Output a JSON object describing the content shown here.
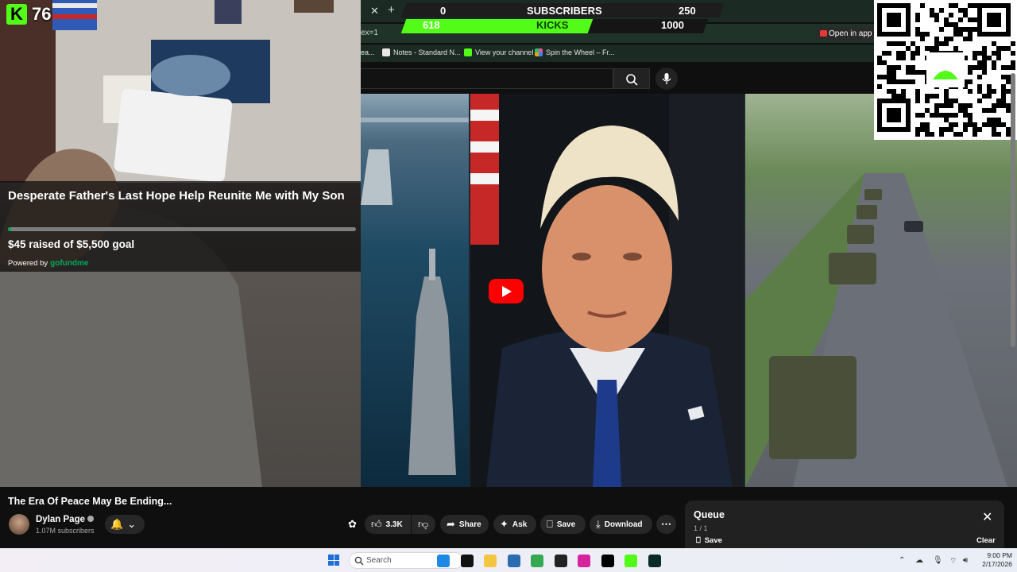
{
  "browser": {
    "address_fragment": "ex=1",
    "open_in_app": "Open in app",
    "bookmarks": [
      {
        "label": "ea...",
        "color": "#7a7a7a"
      },
      {
        "label": "Notes - Standard N...",
        "color": "#e8e8e8"
      },
      {
        "label": "View your channel",
        "color": "#53fc18"
      },
      {
        "label": "Spin the Wheel – Fr...",
        "color": "#e056a0"
      }
    ]
  },
  "goal_widget": {
    "subscribers_label": "SUBSCRIBERS",
    "subscribers_current": "0",
    "subscribers_target": "250",
    "kicks_label": "KICKS",
    "kicks_current": "618",
    "kicks_target": "1000",
    "kicks_progress": 0.618,
    "accent": "#53fc18"
  },
  "stream": {
    "kick_count": "76",
    "brand_color": "#53fc18"
  },
  "fundraiser": {
    "title": "Desperate Father's Last Hope Help Reunite Me with My Son",
    "raised_text": "$45 raised of $5,500 goal",
    "progress": 0.008,
    "powered_by": "Powered by",
    "logo_text": "gofundme",
    "accent": "#02a95c"
  },
  "video": {
    "title": "The Era Of Peace May Be Ending...",
    "channel_name": "Dylan Page",
    "subscribers": "1.07M subscribers",
    "likes": "3.3K",
    "actions": {
      "share": "Share",
      "ask": "Ask",
      "save": "Save",
      "download": "Download"
    }
  },
  "queue": {
    "title": "Queue",
    "count": "1 / 1",
    "save": "Save",
    "clear": "Clear"
  },
  "taskbar": {
    "search_placeholder": "Search",
    "time": "9:00 PM",
    "date": "2/17/2026",
    "apps": [
      {
        "name": "edge-icon",
        "color": "#1e88e5"
      },
      {
        "name": "tiktok-icon",
        "color": "#111111"
      },
      {
        "name": "file-explorer-icon",
        "color": "#f4c542"
      },
      {
        "name": "store-icon",
        "color": "#2b6cb0"
      },
      {
        "name": "chrome-icon",
        "color": "#34a853"
      },
      {
        "name": "amazon-icon",
        "color": "#222222"
      },
      {
        "name": "instagram-icon",
        "color": "#d6249f"
      },
      {
        "name": "x-icon",
        "color": "#000000"
      },
      {
        "name": "kick-icon",
        "color": "#53fc18"
      },
      {
        "name": "media-icon",
        "color": "#0b2a2a"
      }
    ]
  }
}
